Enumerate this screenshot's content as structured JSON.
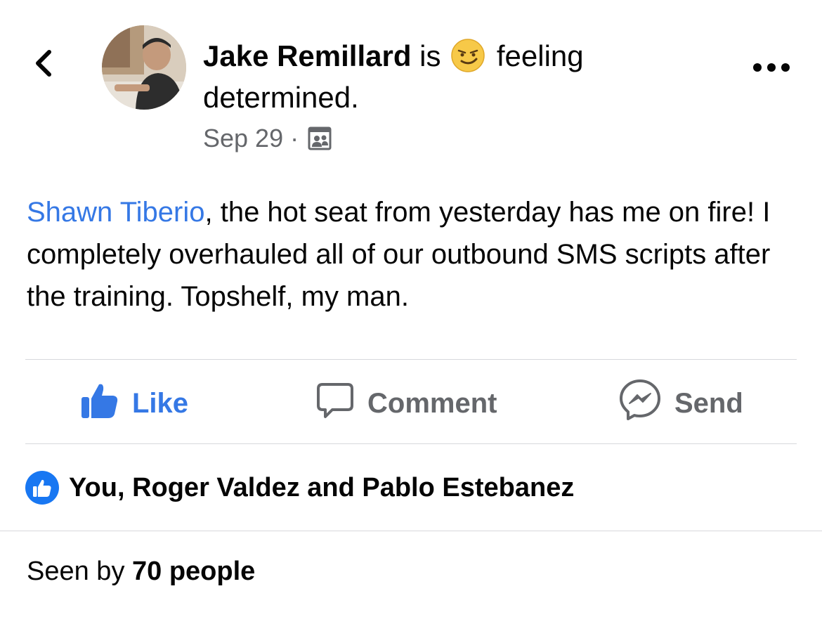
{
  "post": {
    "author": "Jake Remillard",
    "activity_prefix": " is ",
    "activity_icon": "smirking-face-emoji",
    "activity_text": " feeling determined.",
    "date": "Sep 29",
    "meta_separator": "·",
    "audience_icon": "friends-audience-icon",
    "mention": "Shawn Tiberio",
    "body": ", the hot seat from yesterday has me on fire! I completely overhauled all of our outbound SMS scripts after the training. Topshelf, my man."
  },
  "actions": {
    "like_label": "Like",
    "comment_label": "Comment",
    "send_label": "Send"
  },
  "reactions": {
    "names": "You, Roger Valdez and Pablo Estebanez"
  },
  "seen": {
    "prefix": "Seen by ",
    "count": "70 people"
  },
  "colors": {
    "link": "#3578e5",
    "like_blue": "#1877f2",
    "secondary_text": "#65676b",
    "divider": "#d7d8dc"
  }
}
